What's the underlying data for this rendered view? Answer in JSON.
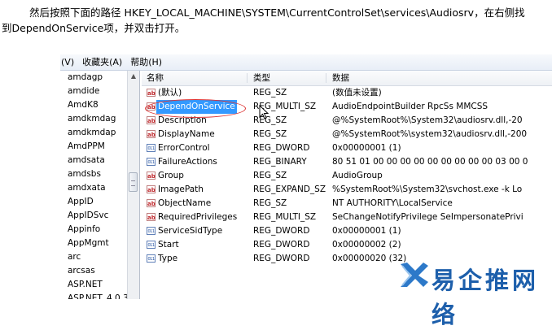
{
  "instruction": {
    "line1": "然后按照下面的路径 HKEY_LOCAL_MACHINE\\SYSTEM\\CurrentControlSet\\services\\Audiosrv，在右侧找",
    "line2": "到DependOnService项，并双击打开。"
  },
  "menu": [
    "(V)",
    "收藏夹(A)",
    "帮助(H)"
  ],
  "tree_items": [
    "amdagp",
    "amdide",
    "AmdK8",
    "amdkmdag",
    "amdkmdap",
    "AmdPPM",
    "amdsata",
    "amdsbs",
    "amdxata",
    "AppID",
    "AppIDSvc",
    "Appinfo",
    "AppMgmt",
    "arc",
    "arcsas",
    "ASP.NET",
    "ASP.NET_4.0.30",
    "aspnet_state"
  ],
  "columns": {
    "name": "名称",
    "type": "类型",
    "data": "数据"
  },
  "values": [
    {
      "icon": "string",
      "name": "(默认)",
      "type": "REG_SZ",
      "data": "(数值未设置)"
    },
    {
      "icon": "string",
      "name": "DependOnService",
      "type": "REG_MULTI_SZ",
      "data": "AudioEndpointBuilder RpcSs MMCSS",
      "selected": true
    },
    {
      "icon": "string",
      "name": "Description",
      "type": "REG_SZ",
      "data": "@%SystemRoot%\\System32\\audiosrv.dll,-20"
    },
    {
      "icon": "string",
      "name": "DisplayName",
      "type": "REG_SZ",
      "data": "@%SystemRoot%\\system32\\audiosrv.dll,-200"
    },
    {
      "icon": "binary",
      "name": "ErrorControl",
      "type": "REG_DWORD",
      "data": "0x00000001 (1)"
    },
    {
      "icon": "binary",
      "name": "FailureActions",
      "type": "REG_BINARY",
      "data": "80 51 01 00 00 00 00 00 00 00 00 00 03 00 0"
    },
    {
      "icon": "string",
      "name": "Group",
      "type": "REG_SZ",
      "data": "AudioGroup"
    },
    {
      "icon": "string",
      "name": "ImagePath",
      "type": "REG_EXPAND_SZ",
      "data": "%SystemRoot%\\System32\\svchost.exe -k Lo"
    },
    {
      "icon": "string",
      "name": "ObjectName",
      "type": "REG_SZ",
      "data": "NT AUTHORITY\\LocalService"
    },
    {
      "icon": "string",
      "name": "RequiredPrivileges",
      "type": "REG_MULTI_SZ",
      "data": "SeChangeNotifyPrivilege SeImpersonatePrivi"
    },
    {
      "icon": "binary",
      "name": "ServiceSidType",
      "type": "REG_DWORD",
      "data": "0x00000001 (1)"
    },
    {
      "icon": "binary",
      "name": "Start",
      "type": "REG_DWORD",
      "data": "0x00000002 (2)"
    },
    {
      "icon": "binary",
      "name": "Type",
      "type": "REG_DWORD",
      "data": "0x00000020 (32)"
    }
  ],
  "watermark": "易企推网络"
}
